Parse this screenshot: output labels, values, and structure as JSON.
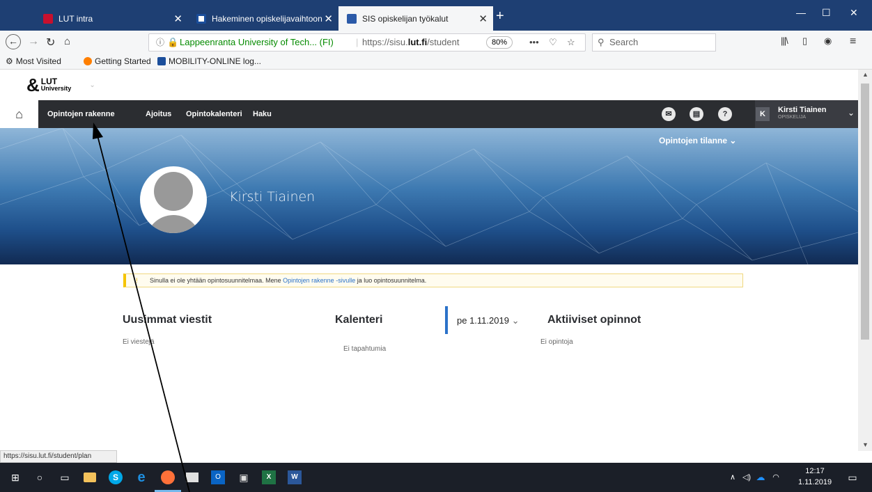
{
  "tabs": [
    {
      "title": "LUT intra",
      "favicon_color": "#c8102e"
    },
    {
      "title": "Hakeminen opiskelijavaihtoon",
      "favicon_color": "#1b4e9b"
    },
    {
      "title": "SIS opiskelijan työkalut",
      "favicon_color": "#2b5aa8"
    }
  ],
  "window_controls": {
    "minimize": "—",
    "maximize": "☐",
    "close": "✕"
  },
  "navbar": {
    "site_identity": "Lappeenranta University of Tech... (FI)",
    "url_prefix": "https://sisu.",
    "url_domain": "lut.fi",
    "url_suffix": "/student",
    "zoom": "80%",
    "search_placeholder": "Search"
  },
  "bookmarks": [
    "Most Visited",
    "Getting Started",
    "MOBILITY-ONLINE log..."
  ],
  "app": {
    "logo_top": "LUT",
    "logo_bottom": "University",
    "nav": [
      "Opintojen rakenne",
      "Ajoitus",
      "Opintokalenteri",
      "Haku"
    ],
    "user_initial": "K",
    "user_name": "Kirsti Tiainen",
    "user_role": "OPISKELIJA",
    "status_menu": "Opintojen tilanne"
  },
  "profile": {
    "name": "Kirsti Tiainen"
  },
  "notice": {
    "before": "Sinulla ei ole yhtään opintosuunnitelmaa. Mene ",
    "link": "Opintojen rakenne -sivulle",
    "after": " ja luo opintosuunnitelma."
  },
  "sections": {
    "messages_title": "Uusimmat viestit",
    "messages_empty": "Ei viestejä",
    "calendar_title": "Kalenteri",
    "calendar_date": "pe 1.11.2019",
    "calendar_empty": "Ei tapahtumia",
    "active_title": "Aktiiviset opinnot",
    "active_empty": "Ei opintoja"
  },
  "statusbar": "https://sisu.lut.fi/student/plan",
  "clock": {
    "time": "12:17",
    "date": "1.11.2019"
  }
}
